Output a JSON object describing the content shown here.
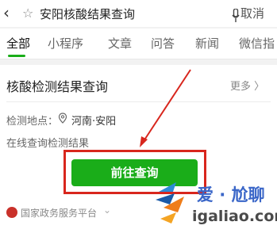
{
  "header": {
    "back_icon": "chevron-left-icon",
    "star_icon": "star-outline-icon",
    "query": "安阳核酸结果查询",
    "mic_icon": "microphone-icon",
    "cancel": "取消"
  },
  "tabs": [
    {
      "label": "全部",
      "active": true
    },
    {
      "label": "小程序"
    },
    {
      "label": "文章"
    },
    {
      "label": "问答"
    },
    {
      "label": "新闻"
    },
    {
      "label": "微信指"
    }
  ],
  "card": {
    "title": "核酸检测结果查询",
    "more": "更多 〉",
    "location_label": "检测地点：",
    "location_icon": "location-pin-icon",
    "location_value": "河南·安阳",
    "description": "在线查询检测结果",
    "button": "前往查询",
    "footer": "国家政务服务平台"
  },
  "watermark": {
    "brand": "爱 · 尬聊",
    "url": "igaliao.com"
  },
  "colors": {
    "accent_green": "#1aad19",
    "highlight_red": "#d8261d"
  }
}
